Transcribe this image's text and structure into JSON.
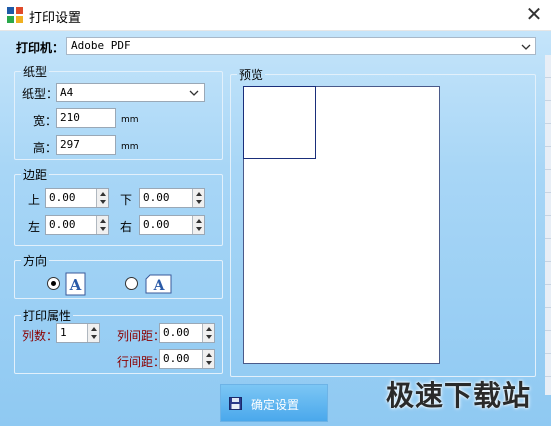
{
  "window": {
    "title": "打印设置"
  },
  "printer": {
    "label": "打印机：",
    "value": "Adobe PDF"
  },
  "paper": {
    "group_title": "纸型",
    "type_label": "纸型：",
    "type_value": "A4",
    "width_label": "宽：",
    "width_value": "210",
    "height_label": "高：",
    "height_value": "297",
    "unit": "mm"
  },
  "margins": {
    "group_title": "边距",
    "top_label": "上",
    "top_value": "0.00",
    "bottom_label": "下",
    "bottom_value": "0.00",
    "left_label": "左",
    "left_value": "0.00",
    "right_label": "右",
    "right_value": "0.00"
  },
  "orientation": {
    "group_title": "方向",
    "selected": "portrait"
  },
  "print_props": {
    "group_title": "打印属性",
    "columns_label": "列数：",
    "columns_value": "1",
    "col_spacing_label": "列间距：",
    "col_spacing_value": "0.00",
    "row_spacing_label": "行间距：",
    "row_spacing_value": "0.00"
  },
  "preview": {
    "group_title": "预览"
  },
  "buttons": {
    "confirm_label": "确定设置"
  },
  "watermark": "极速下载站",
  "colors": {
    "accent": "#4aa8ec",
    "red_label": "#8b0000",
    "background": "#a8d6f6"
  }
}
